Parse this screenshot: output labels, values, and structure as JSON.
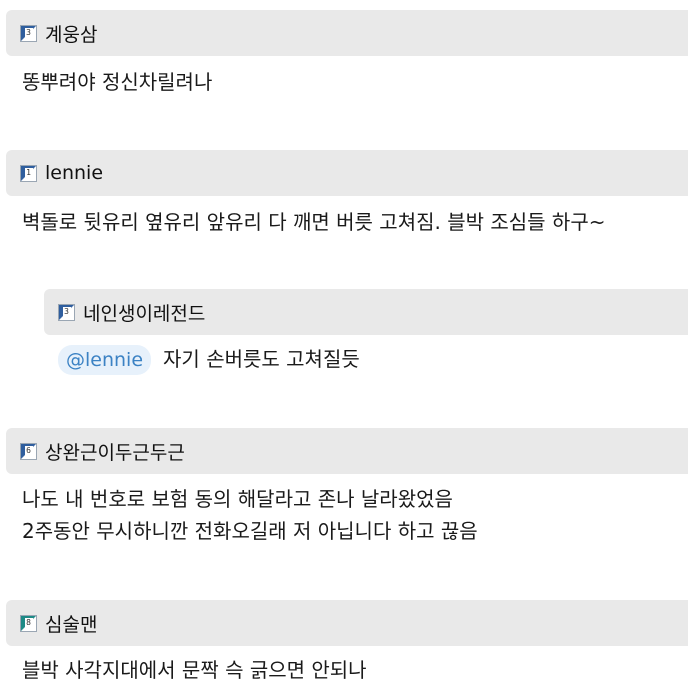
{
  "comments": [
    {
      "author": "계웅삼",
      "level": "3",
      "lines": [
        "똥뿌려야 정신차릴려나"
      ]
    },
    {
      "author": "lennie",
      "level": "1",
      "lines": [
        "벽돌로 뒷유리 옆유리 앞유리 다 깨면 버릇 고쳐짐. 블박 조심들 하구~"
      ]
    },
    {
      "author": "네인생이레전드",
      "level": "3",
      "is_reply": true,
      "mention": "@lennie",
      "lines": [
        "자기 손버릇도 고쳐질듯"
      ]
    },
    {
      "author": "상완근이두근두근",
      "level": "6",
      "lines": [
        "나도 내 번호로 보험 동의 해달라고 존나 날라왔었음",
        "2주동안 무시하니깐 전화오길래 저 아닙니다 하고 끊음"
      ]
    },
    {
      "author": "심술맨",
      "level": "8",
      "lines": [
        "블박 사각지대에서 문짝 슥 긁으면 안되나"
      ]
    }
  ]
}
